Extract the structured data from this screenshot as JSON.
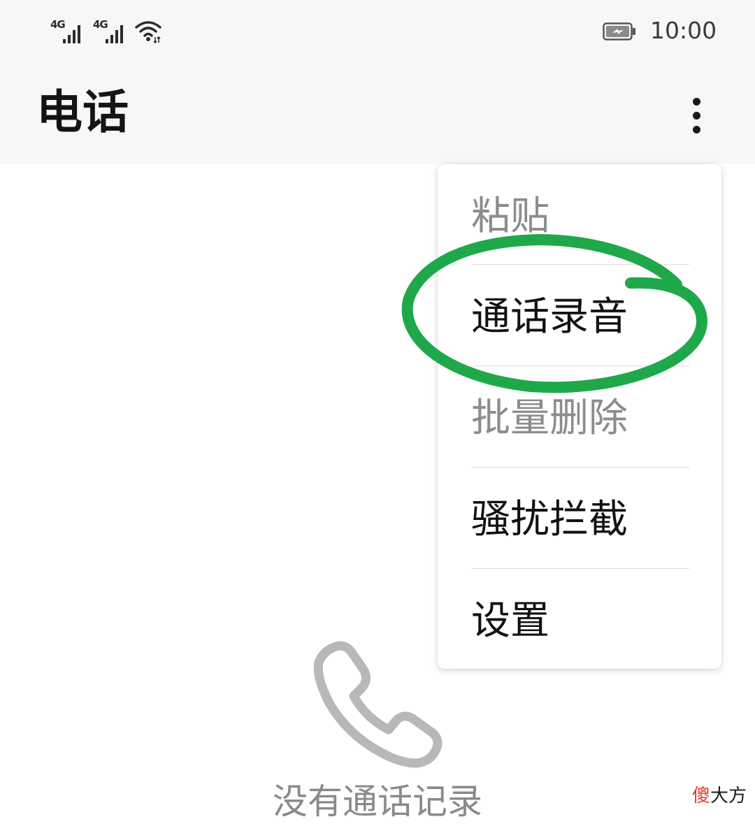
{
  "status_bar": {
    "sim1_network": "4G",
    "sim2_network": "4G",
    "signal_icon": "signal-bars-icon",
    "wifi_icon": "wifi-icon",
    "battery_icon": "battery-charging-icon",
    "time": "10:00"
  },
  "app_bar": {
    "title": "电话",
    "overflow_icon": "more-vertical-icon"
  },
  "overflow_menu": {
    "items": [
      {
        "label": "粘贴",
        "enabled": false
      },
      {
        "label": "通话录音",
        "enabled": true
      },
      {
        "label": "批量删除",
        "enabled": false
      },
      {
        "label": "骚扰拦截",
        "enabled": true
      },
      {
        "label": "设置",
        "enabled": true
      }
    ]
  },
  "annotation": {
    "highlight_color": "#1ea84a",
    "highlighted_item": "通话录音"
  },
  "empty_state": {
    "icon": "phone-handset-icon",
    "message": "没有通话记录"
  },
  "watermark": {
    "first_char": "傻",
    "rest": "大方",
    "first_color": "#e23a2e"
  },
  "colors": {
    "bar_background": "#f7f7f7",
    "text_primary": "#111111",
    "text_disabled": "#8c8c8c",
    "empty_icon": "#b8b8b8"
  }
}
